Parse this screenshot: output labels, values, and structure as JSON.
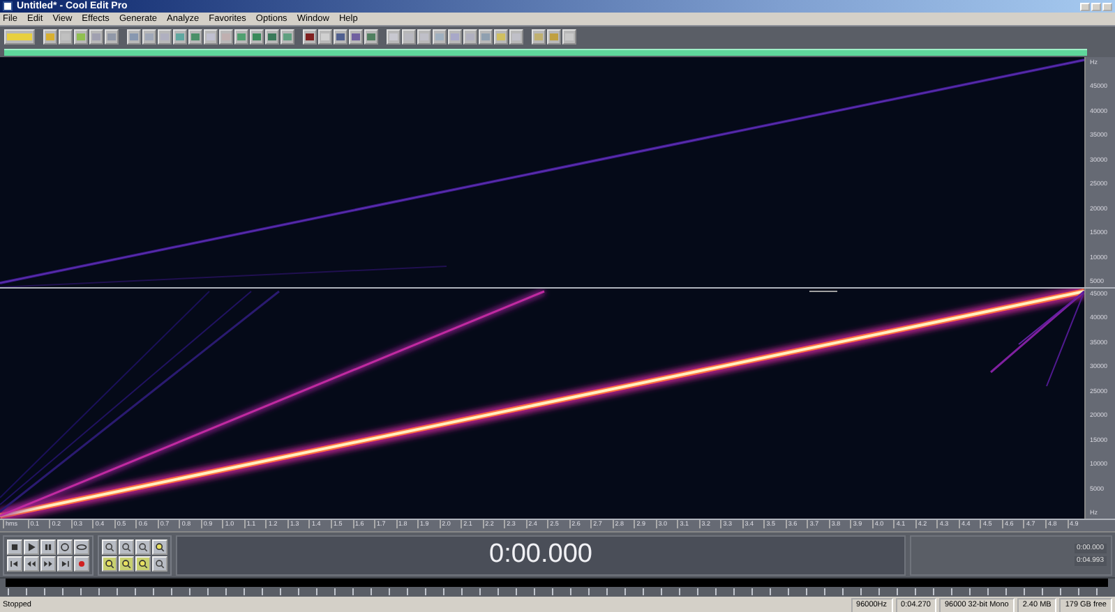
{
  "window": {
    "title": "Untitled* - Cool Edit Pro"
  },
  "menu": [
    "File",
    "Edit",
    "View",
    "Effects",
    "Generate",
    "Analyze",
    "Favorites",
    "Options",
    "Window",
    "Help"
  ],
  "channels": [
    {
      "axis_labels": [
        "Hz",
        "45000",
        "40000",
        "35000",
        "30000",
        "25000",
        "20000",
        "15000",
        "10000",
        "5000"
      ]
    },
    {
      "axis_labels": [
        "45000",
        "40000",
        "35000",
        "30000",
        "25000",
        "20000",
        "15000",
        "10000",
        "5000",
        "Hz"
      ]
    }
  ],
  "time_ruler": {
    "labels": [
      "hms",
      "0.1",
      "0.2",
      "0.3",
      "0.4",
      "0.5",
      "0.6",
      "0.7",
      "0.8",
      "0.9",
      "1.0",
      "1.1",
      "1.2",
      "1.3",
      "1.4",
      "1.5",
      "1.6",
      "1.7",
      "1.8",
      "1.9",
      "2.0",
      "2.1",
      "2.2",
      "2.3",
      "2.4",
      "2.5",
      "2.6",
      "2.7",
      "2.8",
      "2.9",
      "3.0",
      "3.1",
      "3.2",
      "3.3",
      "3.4",
      "3.5",
      "3.6",
      "3.7",
      "3.8",
      "3.9",
      "4.0",
      "4.1",
      "4.2",
      "4.3",
      "4.4",
      "4.5",
      "4.6",
      "4.7",
      "4.8",
      "4.9"
    ]
  },
  "time_display": "0:00.000",
  "selection_fields": [
    "0:00.000",
    "0:04.993"
  ],
  "status_bar": {
    "state": "Stopped",
    "fields": [
      "96000Hz",
      "0:04.270",
      "96000 32-bit Mono",
      "2.40 MB",
      "179 GB free"
    ]
  }
}
